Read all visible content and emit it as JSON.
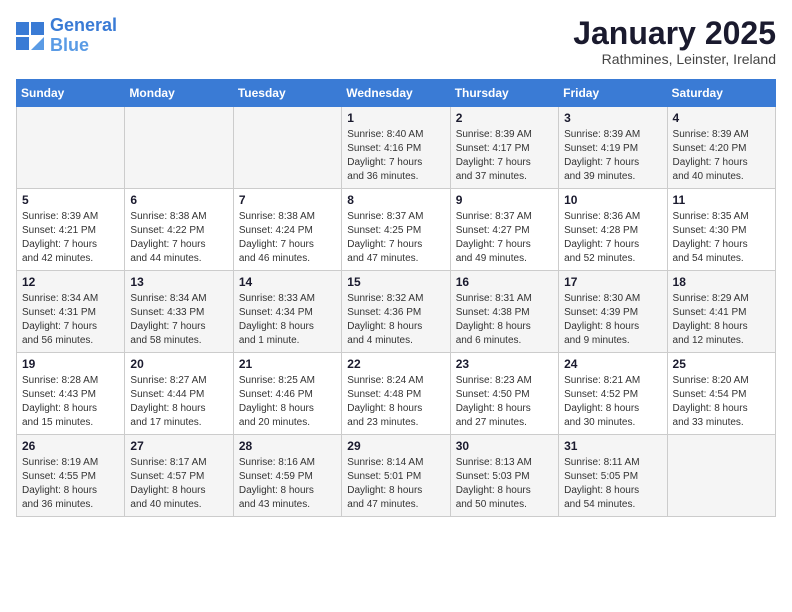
{
  "header": {
    "logo_line1": "General",
    "logo_line2": "Blue",
    "month_title": "January 2025",
    "subtitle": "Rathmines, Leinster, Ireland"
  },
  "weekdays": [
    "Sunday",
    "Monday",
    "Tuesday",
    "Wednesday",
    "Thursday",
    "Friday",
    "Saturday"
  ],
  "weeks": [
    [
      {
        "day": "",
        "content": ""
      },
      {
        "day": "",
        "content": ""
      },
      {
        "day": "",
        "content": ""
      },
      {
        "day": "1",
        "content": "Sunrise: 8:40 AM\nSunset: 4:16 PM\nDaylight: 7 hours\nand 36 minutes."
      },
      {
        "day": "2",
        "content": "Sunrise: 8:39 AM\nSunset: 4:17 PM\nDaylight: 7 hours\nand 37 minutes."
      },
      {
        "day": "3",
        "content": "Sunrise: 8:39 AM\nSunset: 4:19 PM\nDaylight: 7 hours\nand 39 minutes."
      },
      {
        "day": "4",
        "content": "Sunrise: 8:39 AM\nSunset: 4:20 PM\nDaylight: 7 hours\nand 40 minutes."
      }
    ],
    [
      {
        "day": "5",
        "content": "Sunrise: 8:39 AM\nSunset: 4:21 PM\nDaylight: 7 hours\nand 42 minutes."
      },
      {
        "day": "6",
        "content": "Sunrise: 8:38 AM\nSunset: 4:22 PM\nDaylight: 7 hours\nand 44 minutes."
      },
      {
        "day": "7",
        "content": "Sunrise: 8:38 AM\nSunset: 4:24 PM\nDaylight: 7 hours\nand 46 minutes."
      },
      {
        "day": "8",
        "content": "Sunrise: 8:37 AM\nSunset: 4:25 PM\nDaylight: 7 hours\nand 47 minutes."
      },
      {
        "day": "9",
        "content": "Sunrise: 8:37 AM\nSunset: 4:27 PM\nDaylight: 7 hours\nand 49 minutes."
      },
      {
        "day": "10",
        "content": "Sunrise: 8:36 AM\nSunset: 4:28 PM\nDaylight: 7 hours\nand 52 minutes."
      },
      {
        "day": "11",
        "content": "Sunrise: 8:35 AM\nSunset: 4:30 PM\nDaylight: 7 hours\nand 54 minutes."
      }
    ],
    [
      {
        "day": "12",
        "content": "Sunrise: 8:34 AM\nSunset: 4:31 PM\nDaylight: 7 hours\nand 56 minutes."
      },
      {
        "day": "13",
        "content": "Sunrise: 8:34 AM\nSunset: 4:33 PM\nDaylight: 7 hours\nand 58 minutes."
      },
      {
        "day": "14",
        "content": "Sunrise: 8:33 AM\nSunset: 4:34 PM\nDaylight: 8 hours\nand 1 minute."
      },
      {
        "day": "15",
        "content": "Sunrise: 8:32 AM\nSunset: 4:36 PM\nDaylight: 8 hours\nand 4 minutes."
      },
      {
        "day": "16",
        "content": "Sunrise: 8:31 AM\nSunset: 4:38 PM\nDaylight: 8 hours\nand 6 minutes."
      },
      {
        "day": "17",
        "content": "Sunrise: 8:30 AM\nSunset: 4:39 PM\nDaylight: 8 hours\nand 9 minutes."
      },
      {
        "day": "18",
        "content": "Sunrise: 8:29 AM\nSunset: 4:41 PM\nDaylight: 8 hours\nand 12 minutes."
      }
    ],
    [
      {
        "day": "19",
        "content": "Sunrise: 8:28 AM\nSunset: 4:43 PM\nDaylight: 8 hours\nand 15 minutes."
      },
      {
        "day": "20",
        "content": "Sunrise: 8:27 AM\nSunset: 4:44 PM\nDaylight: 8 hours\nand 17 minutes."
      },
      {
        "day": "21",
        "content": "Sunrise: 8:25 AM\nSunset: 4:46 PM\nDaylight: 8 hours\nand 20 minutes."
      },
      {
        "day": "22",
        "content": "Sunrise: 8:24 AM\nSunset: 4:48 PM\nDaylight: 8 hours\nand 23 minutes."
      },
      {
        "day": "23",
        "content": "Sunrise: 8:23 AM\nSunset: 4:50 PM\nDaylight: 8 hours\nand 27 minutes."
      },
      {
        "day": "24",
        "content": "Sunrise: 8:21 AM\nSunset: 4:52 PM\nDaylight: 8 hours\nand 30 minutes."
      },
      {
        "day": "25",
        "content": "Sunrise: 8:20 AM\nSunset: 4:54 PM\nDaylight: 8 hours\nand 33 minutes."
      }
    ],
    [
      {
        "day": "26",
        "content": "Sunrise: 8:19 AM\nSunset: 4:55 PM\nDaylight: 8 hours\nand 36 minutes."
      },
      {
        "day": "27",
        "content": "Sunrise: 8:17 AM\nSunset: 4:57 PM\nDaylight: 8 hours\nand 40 minutes."
      },
      {
        "day": "28",
        "content": "Sunrise: 8:16 AM\nSunset: 4:59 PM\nDaylight: 8 hours\nand 43 minutes."
      },
      {
        "day": "29",
        "content": "Sunrise: 8:14 AM\nSunset: 5:01 PM\nDaylight: 8 hours\nand 47 minutes."
      },
      {
        "day": "30",
        "content": "Sunrise: 8:13 AM\nSunset: 5:03 PM\nDaylight: 8 hours\nand 50 minutes."
      },
      {
        "day": "31",
        "content": "Sunrise: 8:11 AM\nSunset: 5:05 PM\nDaylight: 8 hours\nand 54 minutes."
      },
      {
        "day": "",
        "content": ""
      }
    ]
  ]
}
